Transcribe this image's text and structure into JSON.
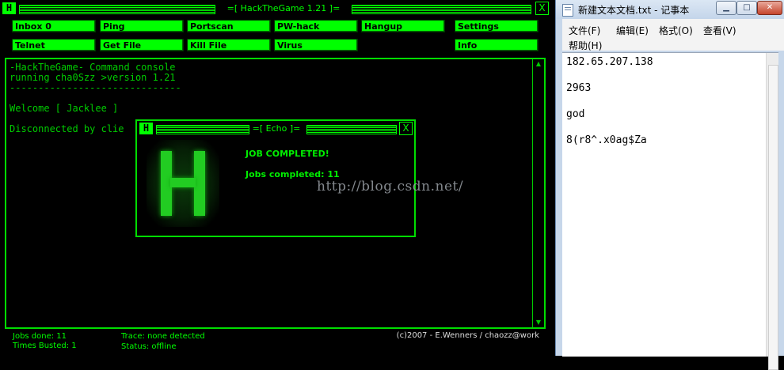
{
  "htg": {
    "title": "=[ HackTheGame 1.21 ]=",
    "close": "X",
    "menu": [
      {
        "label": "Inbox 0"
      },
      {
        "label": "Ping"
      },
      {
        "label": "Portscan"
      },
      {
        "label": "PW-hack"
      },
      {
        "label": "Hangup"
      },
      {
        "label": "Settings"
      },
      {
        "label": "Telnet"
      },
      {
        "label": "Get File"
      },
      {
        "label": "Kill File"
      },
      {
        "label": "Virus"
      },
      {
        "label": "Info"
      }
    ],
    "console": {
      "lines": [
        "-HackTheGame- Command console",
        "running cha0Szz >version 1.21",
        "------------------------------",
        "Welcome [ Jacklee ]",
        "Disconnected by clie"
      ]
    },
    "status": {
      "jobs_done": "Jobs done: 11",
      "times_busted": "Times Busted: 1",
      "trace": "Trace: none detected",
      "state": "Status: offline",
      "copyright": "(c)2007 - E.Wenners / chaozz@work"
    }
  },
  "echo": {
    "title": "=[ Echo ]=",
    "close": "X",
    "message": "JOB COMPLETED!",
    "jobs": "Jobs completed: 11"
  },
  "notepad": {
    "title": "新建文本文档.txt - 记事本",
    "menu": [
      "文件(F)",
      "编辑(E)",
      "格式(O)",
      "查看(V)",
      "帮助(H)"
    ],
    "lines": [
      "182.65.207.138",
      "2963",
      "god",
      "8(r8^.x0ag$Za"
    ]
  },
  "watermark": "http://blog.csdn.net/",
  "colors": {
    "accent": "#00ff00",
    "background": "#000000"
  }
}
